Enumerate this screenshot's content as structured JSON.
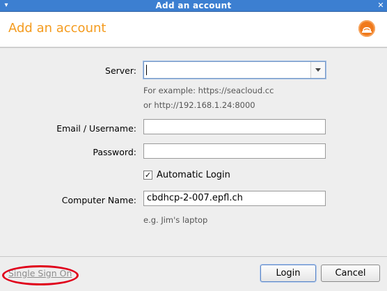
{
  "window": {
    "title": "Add an account",
    "left_icon": "▾",
    "close_icon": "✕"
  },
  "header": {
    "title": "Add an account",
    "logo_icon": "seafile-logo",
    "accent_color": "#f49b1e"
  },
  "form": {
    "server_label": "Server:",
    "server_value": "",
    "server_hint_1": "For example: https://seacloud.cc",
    "server_hint_2": "or http://192.168.1.24:8000",
    "email_label": "Email / Username:",
    "email_value": "",
    "password_label": "Password:",
    "password_value": "",
    "auto_login_label": "Automatic Login",
    "auto_login_checked": true,
    "computer_label": "Computer Name:",
    "computer_value": "cbdhcp-2-007.epfl.ch",
    "computer_hint": "e.g. Jim's laptop"
  },
  "footer": {
    "sso_label": "Single Sign On",
    "login_label": "Login",
    "cancel_label": "Cancel"
  }
}
